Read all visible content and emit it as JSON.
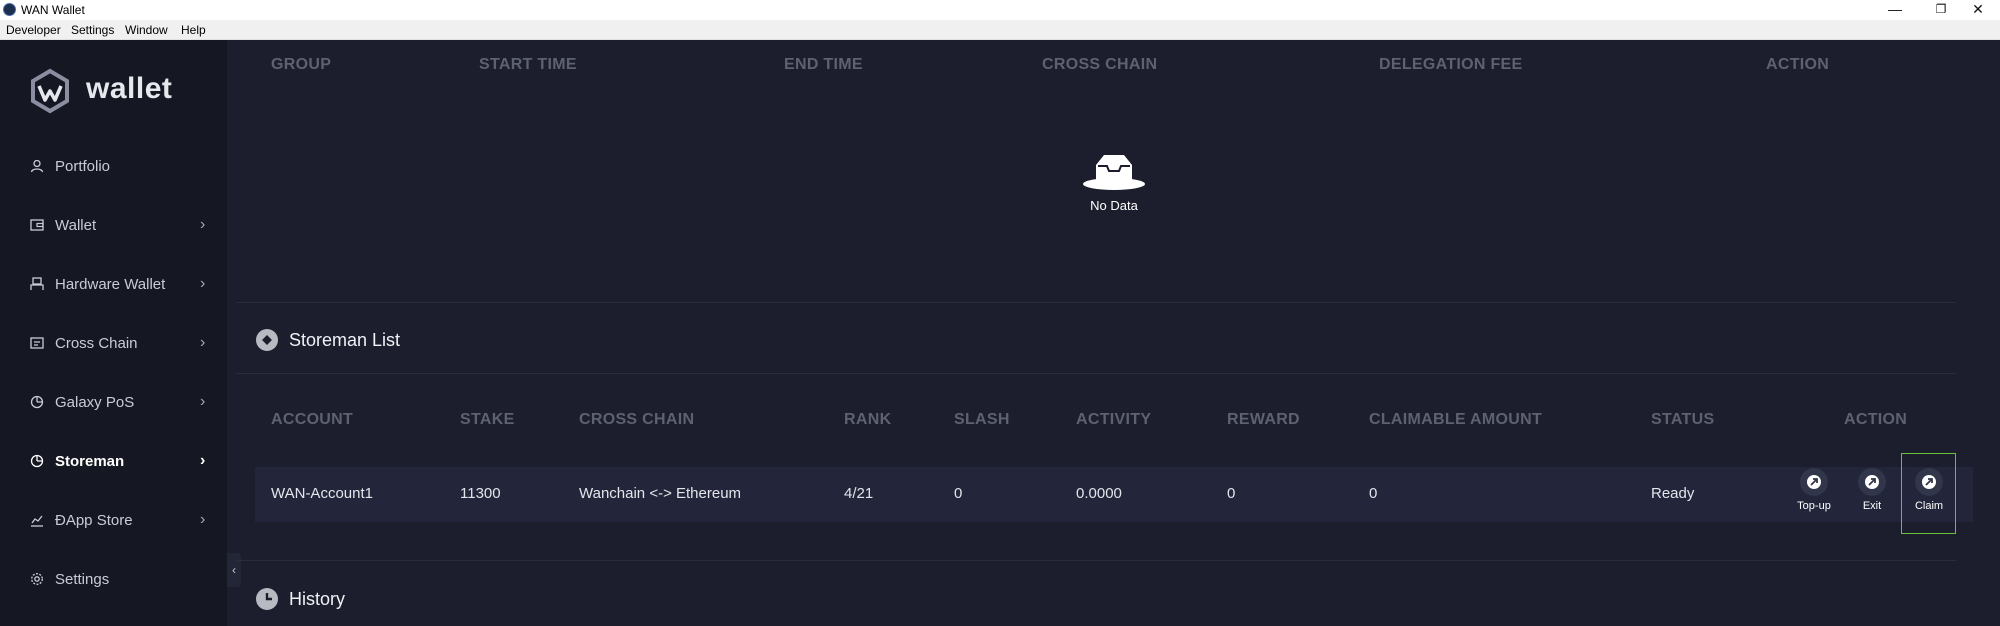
{
  "window": {
    "title": "WAN Wallet",
    "minimize": "—",
    "restore": "❐",
    "close": "✕"
  },
  "menu": [
    "Developer",
    "Settings",
    "Window",
    "Help"
  ],
  "sidebar": {
    "logo_text": "wallet",
    "items": [
      {
        "label": "Portfolio",
        "icon": "user-icon",
        "chevron": ""
      },
      {
        "label": "Wallet",
        "icon": "wallet-icon",
        "chevron": "›"
      },
      {
        "label": "Hardware Wallet",
        "icon": "hardware-icon",
        "chevron": "›"
      },
      {
        "label": "Cross Chain",
        "icon": "cross-chain-icon",
        "chevron": "›"
      },
      {
        "label": "Galaxy PoS",
        "icon": "pie-icon",
        "chevron": "›"
      },
      {
        "label": "Storeman",
        "icon": "pie-icon",
        "chevron": "›"
      },
      {
        "label": "ÐApp Store",
        "icon": "chart-icon",
        "chevron": "›"
      },
      {
        "label": "Settings",
        "icon": "gear-icon",
        "chevron": ""
      }
    ],
    "collapse": "‹"
  },
  "delegation_table": {
    "headers": [
      "GROUP",
      "START TIME",
      "END TIME",
      "CROSS CHAIN",
      "DELEGATION FEE",
      "ACTION"
    ],
    "empty_text": "No Data"
  },
  "storeman_list": {
    "title": "Storeman List",
    "headers": [
      "ACCOUNT",
      "STAKE",
      "CROSS CHAIN",
      "RANK",
      "SLASH",
      "ACTIVITY",
      "REWARD",
      "CLAIMABLE AMOUNT",
      "STATUS",
      "ACTION"
    ],
    "rows": [
      {
        "account": "WAN-Account1",
        "stake": "11300",
        "cross_chain": "Wanchain <-> Ethereum",
        "rank": "4/21",
        "slash": "0",
        "activity": "0.0000",
        "reward": "0",
        "claimable": "0",
        "status": "Ready"
      }
    ],
    "actions": [
      "Top-up",
      "Exit",
      "Claim"
    ]
  },
  "history": {
    "title": "History"
  },
  "colors": {
    "background": "#1c1e2d",
    "sidebar": "#151722",
    "header_text": "#5d6171",
    "highlight": "#67c23a"
  }
}
